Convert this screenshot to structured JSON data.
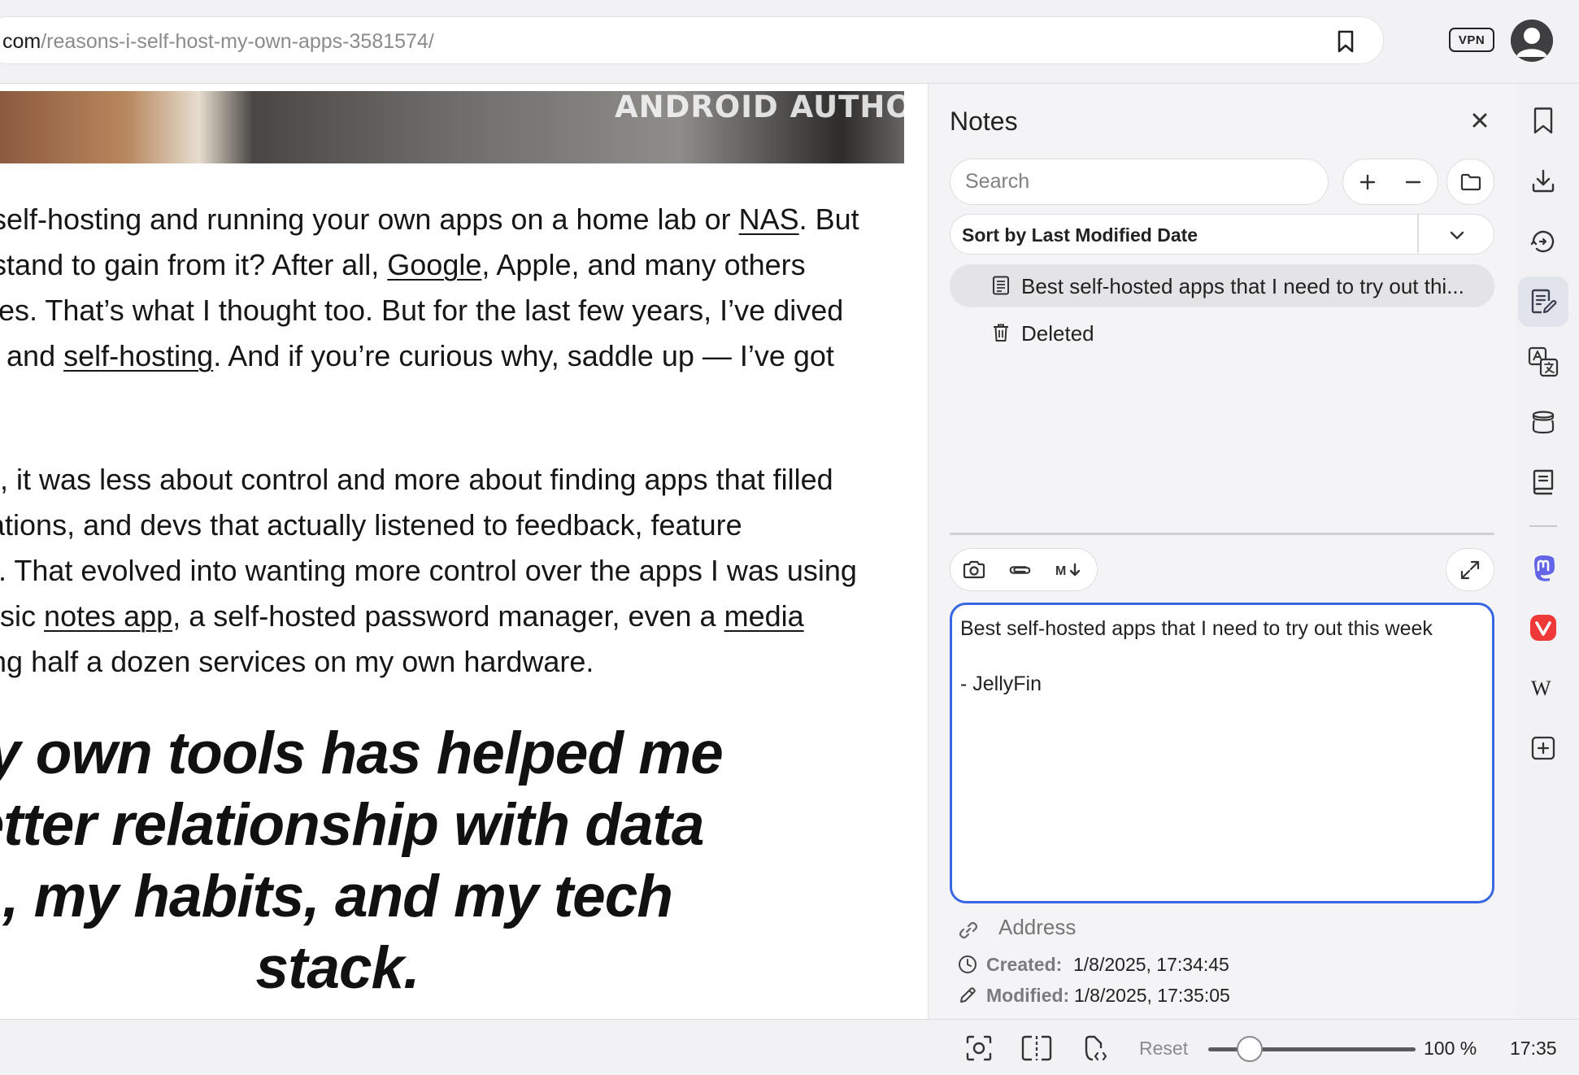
{
  "browser": {
    "url_domain_tail": "com",
    "url_path": "/reasons-i-self-host-my-own-apps-3581574/",
    "vpn_label": "VPN"
  },
  "article": {
    "hero_watermark": "ANDROID AUTHORITY",
    "paragraph1": {
      "l1_a": "d self-hosting and running your own apps on a home lab or ",
      "l1_link": "NAS",
      "l1_b": ". But",
      "l2_a": "u stand to gain from it? After all, ",
      "l2_link": "Google",
      "l2_b": ", Apple, and many others",
      "l3": "uites. That’s what I thought too. But for the last few years, I’ve dived",
      "l4_a": "ce and ",
      "l4_link": "self-hosting",
      "l4_b": ". And if you’re curious why, saddle up — I’ve got"
    },
    "paragraph2": {
      "l1": "ng, it was less about control and more about finding apps that filled",
      "l2": "ications, and devs that actually listened to feedback, feature",
      "l3": "es. That evolved into wanting more control over the apps I was using",
      "l4_a": "basic ",
      "l4_link1": "notes app",
      "l4_b": ", a self-hosted password manager, even a ",
      "l4_link2": "media",
      "l5": "hing half a dozen services on my own hardware."
    },
    "pullquote": {
      "l1": "ny own tools has helped me",
      "l2": "etter relationship with data",
      "l3": ", my habits, and my tech",
      "l4": "stack."
    }
  },
  "notes_panel": {
    "title": "Notes",
    "close_icon": "close-icon",
    "search_placeholder": "Search",
    "sort_label": "Sort by Last Modified Date",
    "items": [
      {
        "label": "Best self-hosted apps that I need to try out thi...",
        "icon": "note-icon",
        "selected": true
      },
      {
        "label": "Deleted",
        "icon": "trash-icon",
        "selected": false
      }
    ],
    "editor_text": "Best self-hosted apps that I need to try out this week\n\n- JellyFin",
    "address_placeholder": "Address",
    "created_label": "Created:",
    "created_value": "1/8/2025, 17:34:45",
    "modified_label": "Modified:",
    "modified_value": "1/8/2025, 17:35:05",
    "accent_color": "#3767e4"
  },
  "sidebar_icons": [
    "bookmarks-icon",
    "downloads-icon",
    "history-icon",
    "notes-icon",
    "translate-icon",
    "reading-list-icon",
    "reader-icon",
    "mastodon-icon",
    "vivaldi-icon",
    "wikipedia-icon",
    "add-panel-icon"
  ],
  "statusbar": {
    "reset_label": "Reset",
    "zoom_value": "100 %",
    "zoom_level_fraction": 0.2,
    "clock": "17:35"
  }
}
